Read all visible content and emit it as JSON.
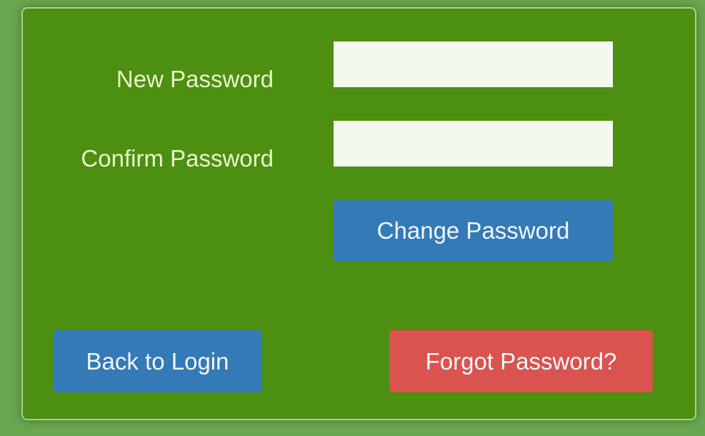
{
  "form": {
    "new_password": {
      "label": "New Password",
      "value": "",
      "placeholder": ""
    },
    "confirm_password": {
      "label": "Confirm Password",
      "value": "",
      "placeholder": ""
    },
    "change_password_label": "Change Password"
  },
  "footer": {
    "back_to_login_label": "Back to Login",
    "forgot_password_label": "Forgot Password?"
  },
  "colors": {
    "page_background": "#6aa84f",
    "panel_background": "#4d8f10",
    "label_text": "#eaf4cf",
    "input_background": "#f2f8ee",
    "primary_button": "#337ab7",
    "danger_button": "#d9534f"
  }
}
